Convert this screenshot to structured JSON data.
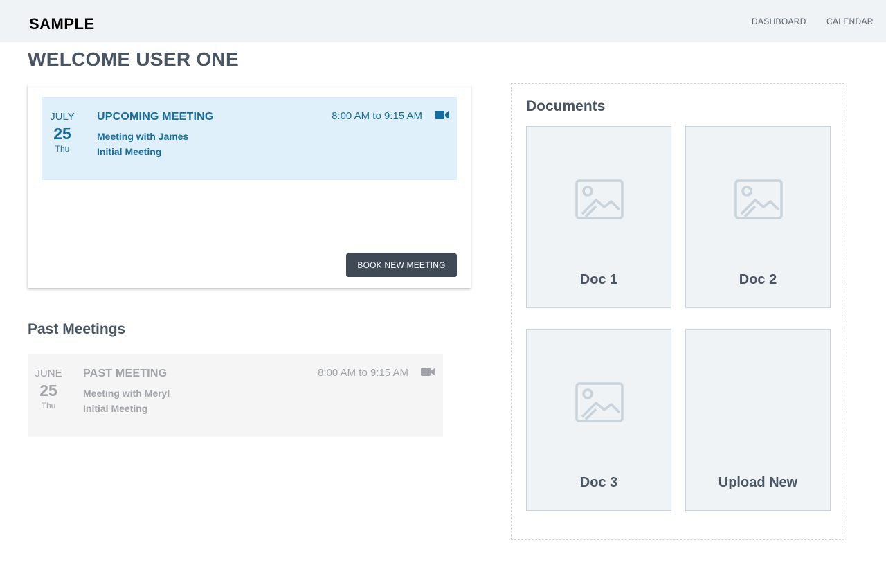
{
  "header": {
    "logo": "SAMPLE",
    "nav": {
      "dashboard": "DASHBOARD",
      "calendar": "CALENDAR"
    }
  },
  "page": {
    "title": "WELCOME USER ONE"
  },
  "upcoming": {
    "month": "JULY",
    "day": "25",
    "weekday": "Thu",
    "title": "UPCOMING MEETING",
    "with": "Meeting with James",
    "type": "Initial Meeting",
    "time": "8:00 AM to 9:15 AM",
    "icon": "video-camera-icon",
    "book_label": "BOOK NEW MEETING"
  },
  "past": {
    "section_title": "Past Meetings",
    "month": "JUNE",
    "day": "25",
    "weekday": "Thu",
    "title": "PAST MEETING",
    "with": "Meeting with Meryl",
    "type": "Initial Meeting",
    "time": "8:00 AM to 9:15 AM",
    "icon": "video-camera-icon"
  },
  "documents": {
    "title": "Documents",
    "items": [
      {
        "label": "Doc 1",
        "icon": "image-placeholder-icon"
      },
      {
        "label": "Doc 2",
        "icon": "image-placeholder-icon"
      },
      {
        "label": "Doc 3",
        "icon": "image-placeholder-icon"
      },
      {
        "label": "Upload New"
      }
    ]
  },
  "colors": {
    "header_bg": "#f0f3f6",
    "upcoming_bg": "#dff0fb",
    "upcoming_text": "#166c9c",
    "past_bg": "#f5f5f5",
    "past_text": "#a1a4a9",
    "button_bg": "#404a57",
    "doc_bg": "#f0f3f6",
    "doc_icon": "#c9d3dc"
  }
}
